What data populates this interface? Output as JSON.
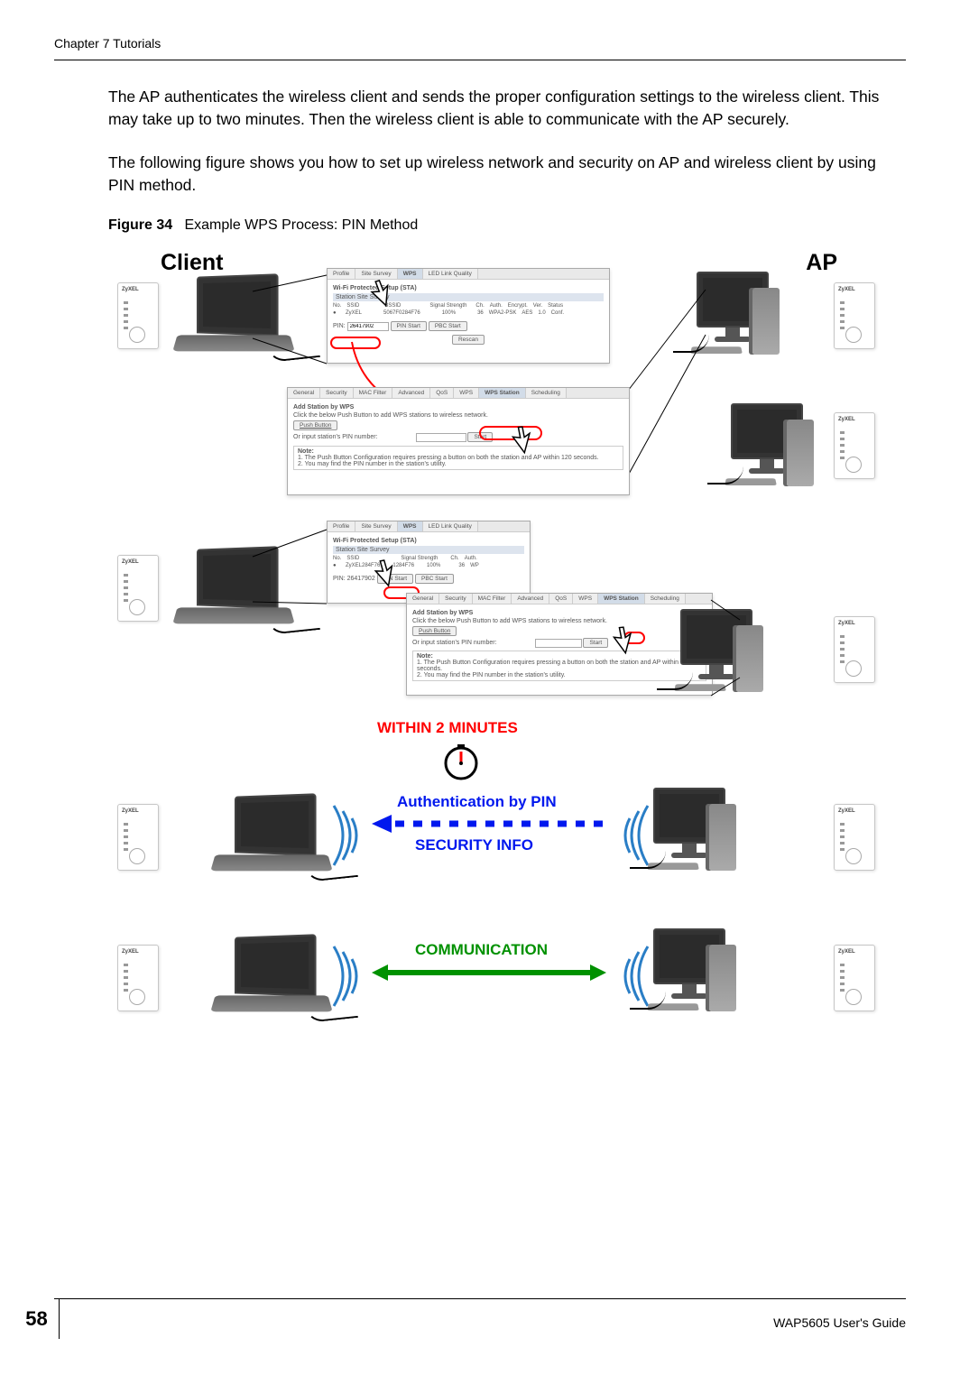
{
  "header": {
    "chapter": "Chapter 7 Tutorials"
  },
  "paragraphs": {
    "p1": "The AP authenticates the wireless client and sends the proper configuration settings to the wireless client. This may take up to two minutes. Then the wireless client is able to communicate with the AP securely.",
    "p2": "The following figure shows you how to set up wireless network and security on AP and wireless client by using PIN method."
  },
  "figure": {
    "label": "Figure 34",
    "caption": "Example WPS Process: PIN Method",
    "client_label": "Client",
    "ap_label": "AP",
    "router_brand": "ZyXEL",
    "within2": "WITHIN 2 MINUTES",
    "auth_by_pin": "Authentication by PIN",
    "security_info": "SECURITY INFO",
    "communication": "COMMUNICATION"
  },
  "ui_client": {
    "tabs": [
      "Profile",
      "Site Survey",
      "WPS",
      "LED Link Quality"
    ],
    "heading": "Wi-Fi Protected Setup (STA)",
    "subheading": "Station Site Survey",
    "cols": [
      "No.",
      "SSID",
      "BSSID",
      "Signal Strength",
      "Ch.",
      "Auth.",
      "Encrypt.",
      "Ver.",
      "Status"
    ],
    "row": [
      "",
      "ZyXEL",
      "5067F0284F76",
      "100%",
      "36",
      "WPA2-PSK",
      "AES",
      "1.0",
      "Conf."
    ],
    "pin_label": "PIN",
    "pin_value": "26417902",
    "pin_start": "PIN Start",
    "pbc_start": "PBC Start",
    "rescan": "Rescan"
  },
  "ui_ap": {
    "tabs": [
      "General",
      "Security",
      "MAC Filter",
      "Advanced",
      "QoS",
      "WPS",
      "WPS Station",
      "Scheduling"
    ],
    "section": "Add Station by WPS",
    "line1": "Click the below Push Button to add WPS stations to wireless network.",
    "push_button": "Push Button",
    "line2": "Or input station's PIN number:",
    "start": "Start",
    "note_title": "Note:",
    "note1": "1. The Push Button Configuration requires pressing a button on both the station and AP within 120 seconds.",
    "note2": "2. You may find the PIN number in the station's utility."
  },
  "footer": {
    "page_number": "58",
    "guide": "WAP5605 User's Guide"
  }
}
